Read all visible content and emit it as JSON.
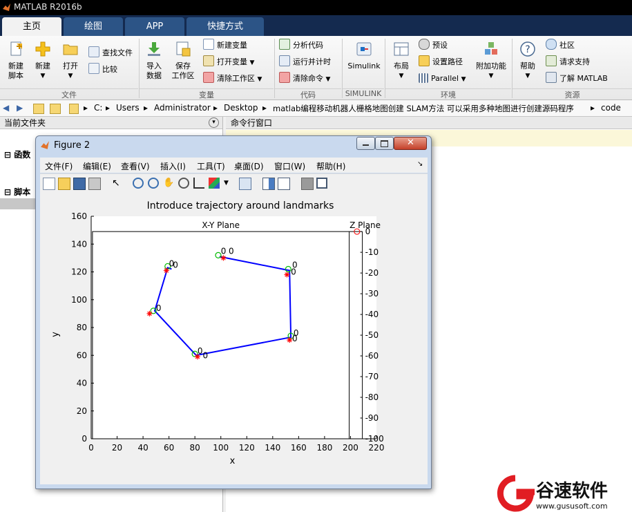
{
  "app": {
    "title": "MATLAB R2016b"
  },
  "tabs": [
    "主页",
    "绘图",
    "APP",
    "快捷方式"
  ],
  "ribbon": {
    "file": {
      "new_script": "新建\n脚本",
      "new": "新建",
      "open": "打开",
      "find_files": "查找文件",
      "compare": "比较",
      "group": "文件"
    },
    "variable": {
      "import": "导入\n数据",
      "save_ws": "保存\n工作区",
      "new_var": "新建变量",
      "open_var": "打开变量",
      "clear_ws": "清除工作区",
      "group": "变量"
    },
    "code": {
      "analyze": "分析代码",
      "run_time": "运行并计时",
      "clear_cmd": "清除命令",
      "group": "代码"
    },
    "simulink": {
      "label": "Simulink",
      "group": "SIMULINK"
    },
    "env": {
      "layout": "布局",
      "prefs": "预设",
      "set_path": "设置路径",
      "parallel": "Parallel",
      "addons": "附加功能",
      "group": "环境"
    },
    "resources": {
      "help": "帮助",
      "community": "社区",
      "support": "请求支持",
      "learn": "了解 MATLAB",
      "group": "资源"
    }
  },
  "address": {
    "path": [
      "C:",
      "Users",
      "Administrator",
      "Desktop",
      "matlab编程移动机器人栅格地图创建 SLAM方法 可以采用多种地图进行创建源码程序",
      "code"
    ]
  },
  "left_panel": {
    "title": "当前文件夹",
    "sections": [
      "函数",
      "脚本"
    ]
  },
  "cmd_panel": {
    "title": "命令行窗口"
  },
  "figure": {
    "title": "Figure 2",
    "menu": [
      "文件(F)",
      "编辑(E)",
      "查看(V)",
      "插入(I)",
      "工具(T)",
      "桌面(D)",
      "窗口(W)",
      "帮助(H)"
    ]
  },
  "chart_data": {
    "type": "line",
    "title": "Introduce trajectory around landmarks",
    "subtitle_left": "X-Y Plane",
    "subtitle_right": "Z Plane",
    "xlabel": "x",
    "ylabel": "y",
    "xlim": [
      0,
      220
    ],
    "ylim": [
      0,
      160
    ],
    "xticks": [
      0,
      20,
      40,
      60,
      80,
      100,
      120,
      140,
      160,
      180,
      200,
      220
    ],
    "yticks": [
      0,
      20,
      40,
      60,
      80,
      100,
      120,
      140,
      160
    ],
    "z_ticks": [
      0,
      -10,
      -20,
      -30,
      -40,
      -50,
      -60,
      -70,
      -80,
      -90,
      -100
    ],
    "box": {
      "x": [
        1,
        199
      ],
      "y": [
        0,
        149
      ]
    },
    "trajectory": [
      {
        "x": 99,
        "y": 131
      },
      {
        "x": 153,
        "y": 121
      },
      {
        "x": 154,
        "y": 73
      },
      {
        "x": 81,
        "y": 60
      },
      {
        "x": 49,
        "y": 92
      },
      {
        "x": 59,
        "y": 123
      },
      {
        "x": 62,
        "y": 122
      }
    ],
    "landmarks_red": [
      {
        "x": 102,
        "y": 130
      },
      {
        "x": 151,
        "y": 118
      },
      {
        "x": 153,
        "y": 71
      },
      {
        "x": 82,
        "y": 59
      },
      {
        "x": 45,
        "y": 90
      },
      {
        "x": 58,
        "y": 121
      }
    ],
    "green_circles": [
      {
        "x": 98,
        "y": 132
      },
      {
        "x": 152,
        "y": 122
      },
      {
        "x": 154,
        "y": 74
      },
      {
        "x": 80,
        "y": 61
      },
      {
        "x": 48,
        "y": 92
      },
      {
        "x": 59,
        "y": 124
      }
    ],
    "point_labels": [
      {
        "x": 100,
        "y": 133,
        "text": "0"
      },
      {
        "x": 106,
        "y": 133,
        "text": "0"
      },
      {
        "x": 155,
        "y": 123,
        "text": "0"
      },
      {
        "x": 154,
        "y": 118,
        "text": "0"
      },
      {
        "x": 156,
        "y": 74,
        "text": "0"
      },
      {
        "x": 155,
        "y": 70,
        "text": "0"
      },
      {
        "x": 82,
        "y": 61,
        "text": "0"
      },
      {
        "x": 86,
        "y": 58,
        "text": "0"
      },
      {
        "x": 50,
        "y": 92,
        "text": "0"
      },
      {
        "x": 60,
        "y": 124,
        "text": "0"
      },
      {
        "x": 63,
        "y": 123,
        "text": "0"
      }
    ],
    "z_marker": {
      "x": 205,
      "z": 0
    },
    "colors": {
      "traj": "#0000ff",
      "landmark": "#ff0000",
      "circle": "#00bb00"
    }
  },
  "watermark": {
    "brand": "谷速软件",
    "url": "www.gususoft.com"
  }
}
